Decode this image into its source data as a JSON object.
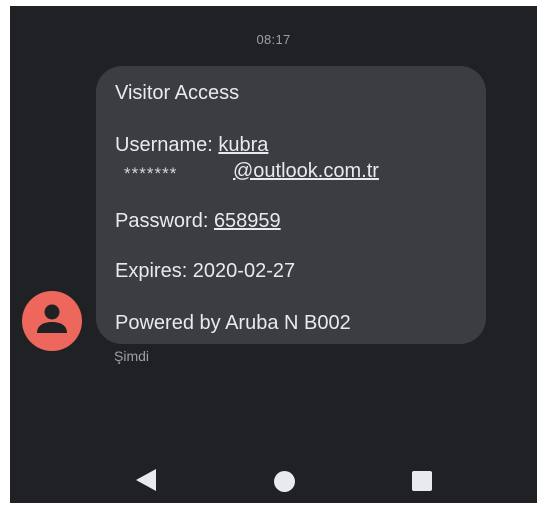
{
  "status": {
    "time": "08:17"
  },
  "message": {
    "title": "Visitor Access",
    "username_label": "Username:",
    "username_value": "kubra",
    "masked": "*******",
    "email_domain": "@outlook.com.tr",
    "password_label": "Password:",
    "password_value": "658959",
    "expires": "Expires: 2020-02-27",
    "footer": "Powered by Aruba N B002",
    "timestamp": "Şimdi"
  },
  "colors": {
    "avatar": "#ee675c",
    "bubble": "#3c3d40",
    "background": "#202124"
  },
  "icons": {
    "avatar": "person-icon",
    "back": "back-triangle-icon",
    "home": "home-circle-icon",
    "recent": "recents-square-icon"
  }
}
